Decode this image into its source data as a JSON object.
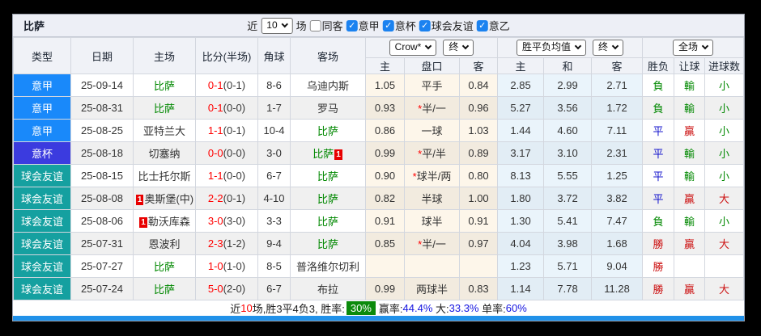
{
  "header": {
    "title": "比萨",
    "recent_label": "近",
    "recent_count": "10",
    "matches_label": "场",
    "same_away": {
      "label": "同客",
      "checked": false
    },
    "filters": [
      {
        "label": "意甲",
        "checked": true
      },
      {
        "label": "意杯",
        "checked": true
      },
      {
        "label": "球会友谊",
        "checked": true
      },
      {
        "label": "意乙",
        "checked": true
      }
    ]
  },
  "table": {
    "main_headers": [
      "类型",
      "日期",
      "主场",
      "比分(半场)",
      "角球",
      "客场"
    ],
    "selects": {
      "odds_source": "Crow*",
      "odds_period": "终",
      "avg_type": "胜平负均值",
      "avg_period": "终",
      "scope": "全场"
    },
    "sub_headers": [
      "主",
      "盘口",
      "客",
      "主",
      "和",
      "客",
      "胜负",
      "让球",
      "进球数"
    ],
    "rows": [
      {
        "type": "意甲",
        "tc": "serie_a",
        "date": "25-09-14",
        "home": {
          "n": "比萨",
          "g": true
        },
        "score": "0-1",
        "half": "(0-1)",
        "corners": "8-6",
        "away": {
          "n": "乌迪内斯"
        },
        "o1": "1.05",
        "hc": {
          "s": false,
          "t": "平手"
        },
        "o2": "0.84",
        "a1": "2.85",
        "a2": "2.99",
        "a3": "2.71",
        "r": [
          {
            "t": "負",
            "c": "green"
          },
          {
            "t": "輸",
            "c": "green"
          },
          {
            "t": "小",
            "c": "green"
          }
        ]
      },
      {
        "type": "意甲",
        "tc": "serie_a",
        "date": "25-08-31",
        "home": {
          "n": "比萨",
          "g": true
        },
        "score": "0-1",
        "half": "(0-0)",
        "corners": "1-7",
        "away": {
          "n": "罗马"
        },
        "o1": "0.93",
        "hc": {
          "s": true,
          "t": "半/一"
        },
        "o2": "0.96",
        "a1": "5.27",
        "a2": "3.56",
        "a3": "1.72",
        "r": [
          {
            "t": "負",
            "c": "green"
          },
          {
            "t": "輸",
            "c": "green"
          },
          {
            "t": "小",
            "c": "green"
          }
        ]
      },
      {
        "type": "意甲",
        "tc": "serie_a",
        "date": "25-08-25",
        "home": {
          "n": "亚特兰大"
        },
        "score": "1-1",
        "half": "(0-1)",
        "corners": "10-4",
        "away": {
          "n": "比萨",
          "g": true
        },
        "o1": "0.86",
        "hc": {
          "s": false,
          "t": "一球"
        },
        "o2": "1.03",
        "a1": "1.44",
        "a2": "4.60",
        "a3": "7.11",
        "r": [
          {
            "t": "平",
            "c": "blue"
          },
          {
            "t": "贏",
            "c": "red"
          },
          {
            "t": "小",
            "c": "green"
          }
        ]
      },
      {
        "type": "意杯",
        "tc": "coppa",
        "date": "25-08-18",
        "home": {
          "n": "切塞纳"
        },
        "score": "0-0",
        "half": "(0-0)",
        "corners": "3-0",
        "away": {
          "n": "比萨",
          "g": true,
          "badge": "1",
          "bp": "after"
        },
        "o1": "0.99",
        "hc": {
          "s": true,
          "t": "平/半"
        },
        "o2": "0.89",
        "a1": "3.17",
        "a2": "3.10",
        "a3": "2.31",
        "r": [
          {
            "t": "平",
            "c": "blue"
          },
          {
            "t": "輸",
            "c": "green"
          },
          {
            "t": "小",
            "c": "green"
          }
        ]
      },
      {
        "type": "球会友谊",
        "tc": "friendly",
        "date": "25-08-15",
        "home": {
          "n": "比士托尔斯"
        },
        "score": "1-1",
        "half": "(0-0)",
        "corners": "6-7",
        "away": {
          "n": "比萨",
          "g": true
        },
        "o1": "0.90",
        "hc": {
          "s": true,
          "t": "球半/两"
        },
        "o2": "0.80",
        "a1": "8.13",
        "a2": "5.55",
        "a3": "1.25",
        "r": [
          {
            "t": "平",
            "c": "blue"
          },
          {
            "t": "輸",
            "c": "green"
          },
          {
            "t": "小",
            "c": "green"
          }
        ]
      },
      {
        "type": "球会友谊",
        "tc": "friendly",
        "date": "25-08-08",
        "home": {
          "n": "奥斯堡(中)",
          "badge": "1",
          "bp": "before"
        },
        "score": "2-2",
        "half": "(0-1)",
        "corners": "4-10",
        "away": {
          "n": "比萨",
          "g": true
        },
        "o1": "0.82",
        "hc": {
          "s": false,
          "t": "半球"
        },
        "o2": "1.00",
        "a1": "1.80",
        "a2": "3.72",
        "a3": "3.82",
        "r": [
          {
            "t": "平",
            "c": "blue"
          },
          {
            "t": "贏",
            "c": "red"
          },
          {
            "t": "大",
            "c": "red"
          }
        ]
      },
      {
        "type": "球会友谊",
        "tc": "friendly",
        "date": "25-08-06",
        "home": {
          "n": "勒沃库森",
          "badge": "1",
          "bp": "before"
        },
        "score": "3-0",
        "half": "(3-0)",
        "corners": "3-3",
        "away": {
          "n": "比萨",
          "g": true
        },
        "o1": "0.91",
        "hc": {
          "s": false,
          "t": "球半"
        },
        "o2": "0.91",
        "a1": "1.30",
        "a2": "5.41",
        "a3": "7.47",
        "r": [
          {
            "t": "負",
            "c": "green"
          },
          {
            "t": "輸",
            "c": "green"
          },
          {
            "t": "小",
            "c": "green"
          }
        ]
      },
      {
        "type": "球会友谊",
        "tc": "friendly",
        "date": "25-07-31",
        "home": {
          "n": "恩波利"
        },
        "score": "2-3",
        "half": "(1-2)",
        "corners": "9-4",
        "away": {
          "n": "比萨",
          "g": true
        },
        "o1": "0.85",
        "hc": {
          "s": true,
          "t": "半/一"
        },
        "o2": "0.97",
        "a1": "4.04",
        "a2": "3.98",
        "a3": "1.68",
        "r": [
          {
            "t": "勝",
            "c": "red"
          },
          {
            "t": "贏",
            "c": "red"
          },
          {
            "t": "大",
            "c": "red"
          }
        ]
      },
      {
        "type": "球会友谊",
        "tc": "friendly",
        "date": "25-07-27",
        "home": {
          "n": "比萨",
          "g": true
        },
        "score": "1-0",
        "half": "(1-0)",
        "corners": "8-5",
        "away": {
          "n": "普洛维尔切利"
        },
        "o1": "",
        "hc": {
          "s": false,
          "t": ""
        },
        "o2": "",
        "a1": "1.23",
        "a2": "5.71",
        "a3": "9.04",
        "r": [
          {
            "t": "勝",
            "c": "red"
          },
          {
            "t": "",
            "c": ""
          },
          {
            "t": "",
            "c": ""
          }
        ]
      },
      {
        "type": "球会友谊",
        "tc": "friendly",
        "date": "25-07-24",
        "home": {
          "n": "比萨",
          "g": true
        },
        "score": "5-0",
        "half": "(2-0)",
        "corners": "6-7",
        "away": {
          "n": "布拉"
        },
        "o1": "0.99",
        "hc": {
          "s": false,
          "t": "两球半"
        },
        "o2": "0.83",
        "a1": "1.14",
        "a2": "7.78",
        "a3": "11.28",
        "r": [
          {
            "t": "勝",
            "c": "red"
          },
          {
            "t": "贏",
            "c": "red"
          },
          {
            "t": "大",
            "c": "red"
          }
        ]
      }
    ]
  },
  "footer": {
    "prefix": "近",
    "count": "10",
    "summary": "场,胜3平4负3, 胜率:",
    "win_rate": "30%",
    "seg2_label": "赢率:",
    "seg2_value": "44.4%",
    "seg3_label": " 大:",
    "seg3_value": "33.3%",
    "seg4_label": " 单率:",
    "seg4_value": "60%"
  },
  "colors": {
    "serie_a": "#1989fa",
    "coppa": "#3b3bdf",
    "friendly": "#15a0a0",
    "green": "#008800",
    "blue": "#1414cc",
    "red": "#cc1111",
    "score_red": "#ff0000",
    "pisa_green": "#008800",
    "checkbox_blue": "#1b82f0",
    "winrate_badge_green": "#0b8a0b",
    "footer_value_blue": "#1515e0",
    "bottom_bar_blue": "#2191e9"
  }
}
